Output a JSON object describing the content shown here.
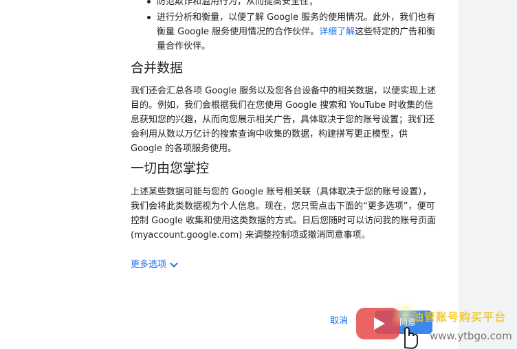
{
  "bullets": [
    {
      "text": "防范欺诈和滥用行为，从而提高安全性；"
    },
    {
      "text_before": "进行分析和衡量，以便了解 Google 服务的使用情况。此外，我们也有衡量 Google 服务使用情况的合作伙伴。",
      "link": "详细了解",
      "text_after": "这些特定的广告和衡量合作伙伴。"
    }
  ],
  "sections": [
    {
      "heading": "合并数据",
      "body": "我们还会汇总各项 Google 服务以及您各台设备中的相关数据，以便实现上述目的。例如，我们会根据我们在您使用 Google 搜索和 YouTube 时收集的信息获知您的兴趣，从而向您展示相关广告，具体取决于您的账号设置；我们还会利用从数以万亿计的搜索查询中收集的数据，构建拼写更正模型，供 Google 的各项服务使用。"
    },
    {
      "heading": "一切由您掌控",
      "body": "上述某些数据可能与您的 Google 账号相关联（具体取决于您的账号设置），我们会将此类数据视为个人信息。现在，您只需点击下面的“更多选项”，便可控制 Google 收集和使用这类数据的方式。日后您随时可以访问我的账号页面 (myaccount.google.com) 来调整控制项或撤消同意事项。"
    }
  ],
  "more_options": {
    "label": "更多选项",
    "icon": "chevron-down-icon"
  },
  "actions": {
    "cancel": "取消",
    "agree": "我同意"
  },
  "watermark": {
    "text": "油管账号购买平台",
    "url": "www.ytbgo.com"
  },
  "colors": {
    "link": "#1a73e8",
    "text": "#202124",
    "gutter": "#f1f3f4"
  }
}
